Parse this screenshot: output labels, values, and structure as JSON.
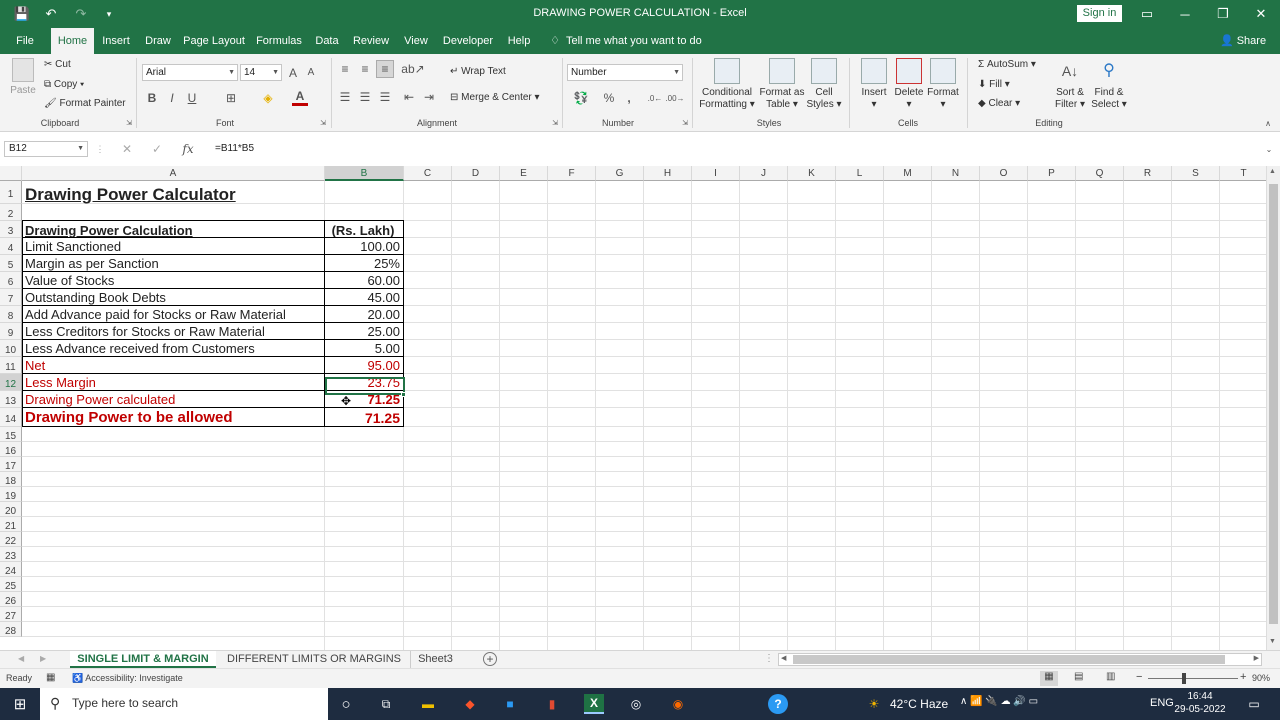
{
  "window": {
    "title": "DRAWING POWER CALCULATION",
    "app": "Excel",
    "title_sep": " - ",
    "sign_in": "Sign in"
  },
  "menu": {
    "tabs": [
      "File",
      "Home",
      "Insert",
      "Draw",
      "Page Layout",
      "Formulas",
      "Data",
      "Review",
      "View",
      "Developer",
      "Help"
    ],
    "tell_me": "Tell me what you want to do",
    "share": "Share"
  },
  "ribbon": {
    "clipboard": {
      "paste": "Paste",
      "cut": "Cut",
      "copy": "Copy",
      "format_painter": "Format Painter",
      "label": "Clipboard"
    },
    "font": {
      "name": "Arial",
      "size": "14",
      "bold": "B",
      "italic": "I",
      "underline": "U",
      "label": "Font"
    },
    "alignment": {
      "wrap": "Wrap Text",
      "merge": "Merge & Center",
      "label": "Alignment"
    },
    "number": {
      "format": "Number",
      "percent": "%",
      "comma": ",",
      "label": "Number"
    },
    "styles": {
      "conditional": "Conditional",
      "conditional2": "Formatting",
      "format_as": "Format as",
      "format_as2": "Table",
      "cell": "Cell",
      "cell2": "Styles",
      "label": "Styles"
    },
    "cells": {
      "insert": "Insert",
      "delete": "Delete",
      "format": "Format",
      "label": "Cells"
    },
    "editing": {
      "autosum": "AutoSum",
      "fill": "Fill",
      "clear": "Clear",
      "sort": "Sort &",
      "sort2": "Filter",
      "find": "Find &",
      "find2": "Select",
      "label": "Editing"
    }
  },
  "formula_bar": {
    "name_box": "B12",
    "fx": "fx",
    "formula": "=B11*B5"
  },
  "sheet": {
    "columns": [
      "A",
      "B",
      "C",
      "D",
      "E",
      "F",
      "G",
      "H",
      "I",
      "J",
      "K",
      "L",
      "M",
      "N",
      "O",
      "P",
      "Q",
      "R",
      "S",
      "T"
    ],
    "rows": [
      "1",
      "2",
      "3",
      "4",
      "5",
      "6",
      "7",
      "8",
      "9",
      "10",
      "11",
      "12",
      "13",
      "14",
      "15",
      "16",
      "17",
      "18",
      "19",
      "20",
      "21",
      "22",
      "23",
      "24",
      "25",
      "26",
      "27",
      "28"
    ],
    "title": "Drawing Power Calculator",
    "header_label": "Drawing Power Calculation",
    "header_unit": "(Rs. Lakh)",
    "lines": [
      {
        "label": "Limit Sanctioned",
        "value": "100.00"
      },
      {
        "label": "Margin as per Sanction",
        "value": "25%"
      },
      {
        "label": "Value of Stocks",
        "value": "60.00"
      },
      {
        "label": "Outstanding Book Debts",
        "value": "45.00"
      },
      {
        "label": "Add Advance paid for Stocks or Raw Material",
        "value": "20.00"
      },
      {
        "label": "Less Creditors for Stocks or Raw Material",
        "value": "25.00"
      },
      {
        "label": "Less Advance received from Customers",
        "value": "5.00"
      },
      {
        "label": "Net",
        "value": "95.00"
      },
      {
        "label": "Less Margin",
        "value": "23.75"
      },
      {
        "label": "Drawing Power calculated",
        "value": "71.25"
      },
      {
        "label": "Drawing Power to be allowed",
        "value": "71.25"
      }
    ],
    "accent_color": "#c00000"
  },
  "sheet_tabs": [
    "SINGLE LIMIT & MARGIN",
    "DIFFERENT LIMITS OR MARGINS",
    "Sheet3"
  ],
  "status": {
    "ready": "Ready",
    "accessibility": "Accessibility: Investigate",
    "zoom": "90%"
  },
  "taskbar": {
    "search": "Type here to search",
    "weather": "42°C Haze",
    "lang": "ENG",
    "time": "16:44",
    "date": "29-05-2022"
  }
}
